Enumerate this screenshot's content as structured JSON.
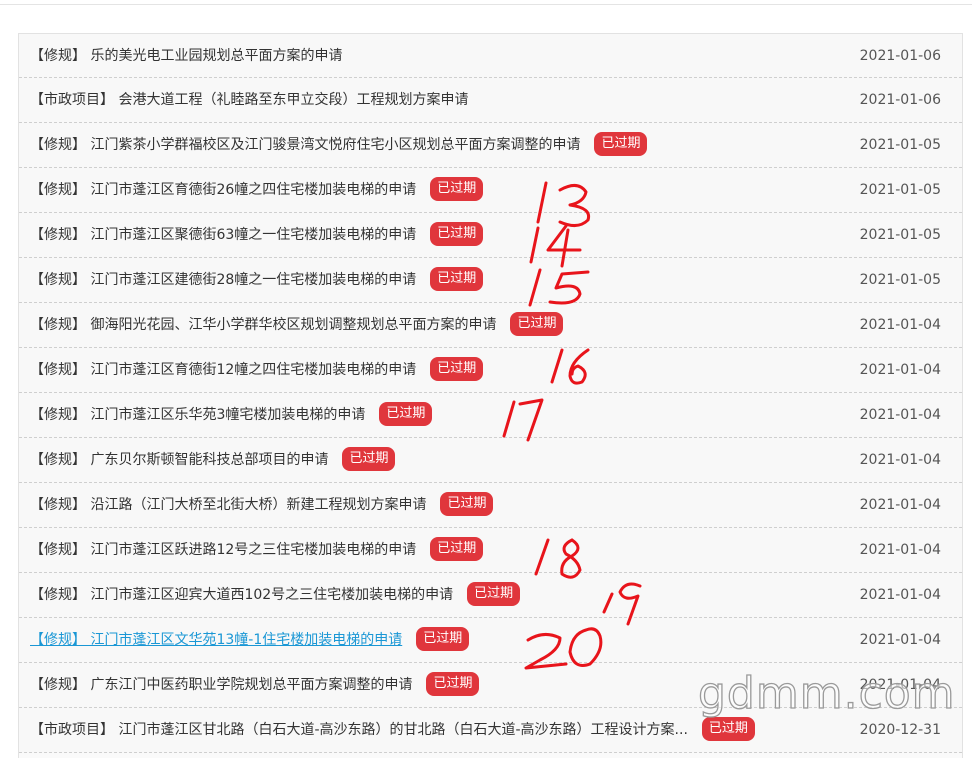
{
  "badge_text": "已过期",
  "colors": {
    "badge": "#e0363c",
    "link_active": "#1a97d5",
    "annotation": "#e8141b"
  },
  "items": [
    {
      "title": "【修规】 乐的美光电工业园规划总平面方案的申请",
      "date": "2021-01-06",
      "expired": false,
      "active": false
    },
    {
      "title": "【市政项目】 会港大道工程（礼睦路至东甲立交段）工程规划方案申请",
      "date": "2021-01-06",
      "expired": false,
      "active": false
    },
    {
      "title": "【修规】 江门紫茶小学群福校区及江门骏景湾文悦府住宅小区规划总平面方案调整的申请",
      "date": "2021-01-05",
      "expired": true,
      "active": false
    },
    {
      "title": "【修规】 江门市蓬江区育德街26幢之四住宅楼加装电梯的申请",
      "date": "2021-01-05",
      "expired": true,
      "active": false
    },
    {
      "title": "【修规】 江门市蓬江区聚德街63幢之一住宅楼加装电梯的申请",
      "date": "2021-01-05",
      "expired": true,
      "active": false
    },
    {
      "title": "【修规】 江门市蓬江区建德街28幢之一住宅楼加装电梯的申请",
      "date": "2021-01-05",
      "expired": true,
      "active": false
    },
    {
      "title": "【修规】 御海阳光花园、江华小学群华校区规划调整规划总平面方案的申请",
      "date": "2021-01-04",
      "expired": true,
      "active": false
    },
    {
      "title": "【修规】 江门市蓬江区育德街12幢之四住宅楼加装电梯的申请",
      "date": "2021-01-04",
      "expired": true,
      "active": false
    },
    {
      "title": "【修规】 江门市蓬江区乐华苑3幢宅楼加装电梯的申请",
      "date": "2021-01-04",
      "expired": true,
      "active": false
    },
    {
      "title": "【修规】 广东贝尔斯顿智能科技总部项目的申请",
      "date": "2021-01-04",
      "expired": true,
      "active": false
    },
    {
      "title": "【修规】 沿江路（江门大桥至北街大桥）新建工程规划方案申请",
      "date": "2021-01-04",
      "expired": true,
      "active": false
    },
    {
      "title": "【修规】 江门市蓬江区跃进路12号之三住宅楼加装电梯的申请",
      "date": "2021-01-04",
      "expired": true,
      "active": false
    },
    {
      "title": "【修规】 江门市蓬江区迎宾大道西102号之三住宅楼加装电梯的申请",
      "date": "2021-01-04",
      "expired": true,
      "active": false
    },
    {
      "title": "【修规】 江门市蓬江区文华苑13幢-1住宅楼加装电梯的申请",
      "date": "2021-01-04",
      "expired": true,
      "active": true
    },
    {
      "title": "【修规】 广东江门中医药职业学院规划总平面方案调整的申请",
      "date": "2021-01-04",
      "expired": true,
      "active": false
    },
    {
      "title": "【市政项目】 江门市蓬江区甘北路（白石大道-高沙东路）的甘北路（白石大道-高沙东路）工程设计方案...",
      "date": "2020-12-31",
      "expired": true,
      "active": false
    }
  ],
  "handwritten_numbers": [
    "13",
    "14",
    "15",
    "16",
    "17",
    "18",
    "19",
    "20"
  ],
  "watermark": "gdmm.com"
}
